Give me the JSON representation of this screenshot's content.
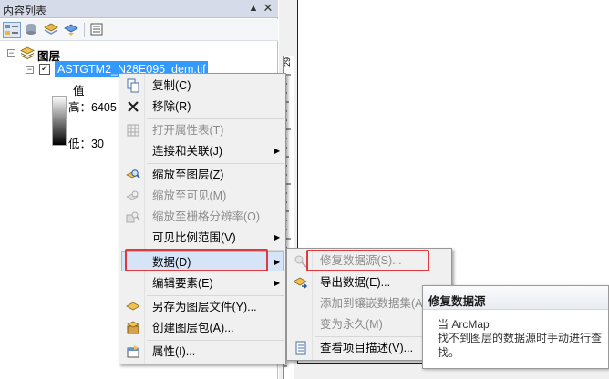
{
  "toc": {
    "title": "内容列表",
    "pin_icon": "pin-icon",
    "close_icon": "close-icon",
    "toolbar_icons": [
      "list-by-drawing-order-icon",
      "list-by-source-icon",
      "list-by-visibility-icon",
      "list-by-selection-icon",
      "options-icon"
    ],
    "group_label": "图层",
    "layer_name": "ASTGTM2_N28E095_dem.tif",
    "legend_field": "值",
    "high_label": "高：6405",
    "low_label": "低：30"
  },
  "ruler": {
    "label": "29"
  },
  "context_menu": {
    "items": [
      {
        "label": "复制(C)",
        "icon": "copy-icon",
        "disabled": false
      },
      {
        "label": "移除(R)",
        "icon": "remove-x-icon",
        "disabled": false
      },
      {
        "label": "打开属性表(T)",
        "icon": "table-icon",
        "disabled": true
      },
      {
        "label": "连接和关联(J)",
        "icon": "",
        "disabled": false,
        "submenu": true
      },
      {
        "label": "缩放至图层(Z)",
        "icon": "zoom-to-layer-icon",
        "disabled": false
      },
      {
        "label": "缩放至可见(M)",
        "icon": "zoom-to-visible-icon",
        "disabled": true
      },
      {
        "label": "缩放至栅格分辨率(O)",
        "icon": "zoom-to-raster-resolution-icon",
        "disabled": true
      },
      {
        "label": "可见比例范围(V)",
        "icon": "",
        "disabled": false,
        "submenu": true
      },
      {
        "label": "数据(D)",
        "icon": "",
        "disabled": false,
        "submenu": true,
        "highlighted": true
      },
      {
        "label": "编辑要素(E)",
        "icon": "",
        "disabled": false,
        "submenu": true
      },
      {
        "label": "另存为图层文件(Y)...",
        "icon": "layer-file-icon",
        "disabled": false
      },
      {
        "label": "创建图层包(A)...",
        "icon": "layer-package-icon",
        "disabled": false
      },
      {
        "label": "属性(I)...",
        "icon": "properties-icon",
        "disabled": false
      }
    ]
  },
  "data_submenu": {
    "items": [
      {
        "label": "修复数据源(S)...",
        "icon": "repair-data-source-icon",
        "disabled": true
      },
      {
        "label": "导出数据(E)...",
        "icon": "export-data-icon",
        "disabled": false
      },
      {
        "label": "添加到镶嵌数据集(A)",
        "icon": "",
        "disabled": true
      },
      {
        "label": "变为永久(M)",
        "icon": "",
        "disabled": true
      },
      {
        "label": "查看项目描述(V)...",
        "icon": "item-description-icon",
        "disabled": false
      }
    ]
  },
  "tooltip": {
    "title": "修复数据源",
    "subtitle": "当 ArcMap",
    "description": "找不到图层的数据源时手动进行查找。"
  },
  "colors": {
    "selection": "#3399ff",
    "highlight_bg": "#d5e5f7",
    "red_outline": "#e2393c",
    "toc_title_bg": "#d6dbe9"
  }
}
